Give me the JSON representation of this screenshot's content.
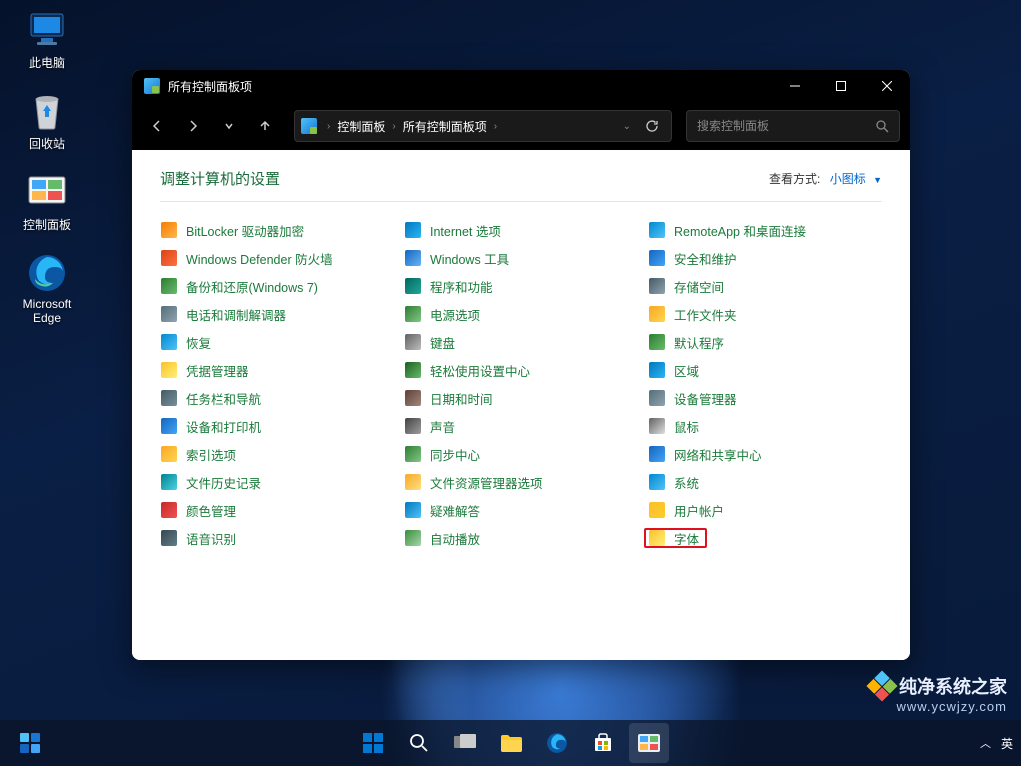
{
  "desktop": {
    "icons": [
      {
        "name": "this-pc",
        "label": "此电脑"
      },
      {
        "name": "recycle-bin",
        "label": "回收站"
      },
      {
        "name": "control-panel",
        "label": "控制面板"
      },
      {
        "name": "edge",
        "label": "Microsoft Edge"
      }
    ]
  },
  "window": {
    "title": "所有控制面板项",
    "breadcrumb": [
      "控制面板",
      "所有控制面板项"
    ],
    "search_placeholder": "搜索控制面板",
    "heading": "调整计算机的设置",
    "viewby_label": "查看方式:",
    "viewby_value": "小图标"
  },
  "items": {
    "col1": [
      {
        "name": "bitlocker",
        "label": "BitLocker 驱动器加密",
        "bg": "linear-gradient(135deg,#f57c00,#ffb74d)"
      },
      {
        "name": "defender",
        "label": "Windows Defender 防火墙",
        "bg": "linear-gradient(135deg,#d84315,#ff7043)"
      },
      {
        "name": "backup",
        "label": "备份和还原(Windows 7)",
        "bg": "linear-gradient(135deg,#2e7d32,#66bb6a)"
      },
      {
        "name": "phone-modem",
        "label": "电话和调制解调器",
        "bg": "linear-gradient(135deg,#546e7a,#90a4ae)"
      },
      {
        "name": "recovery",
        "label": "恢复",
        "bg": "linear-gradient(135deg,#0288d1,#4fc3f7)"
      },
      {
        "name": "credential",
        "label": "凭据管理器",
        "bg": "linear-gradient(135deg,#fbc02d,#fff176)"
      },
      {
        "name": "taskbar-nav",
        "label": "任务栏和导航",
        "bg": "linear-gradient(135deg,#455a64,#78909c)"
      },
      {
        "name": "devices-printers",
        "label": "设备和打印机",
        "bg": "linear-gradient(135deg,#1565c0,#42a5f5)"
      },
      {
        "name": "index-options",
        "label": "索引选项",
        "bg": "linear-gradient(135deg,#f9a825,#ffd54f)"
      },
      {
        "name": "file-history",
        "label": "文件历史记录",
        "bg": "linear-gradient(135deg,#00838f,#4dd0e1)"
      },
      {
        "name": "color-mgmt",
        "label": "颜色管理",
        "bg": "linear-gradient(135deg,#c62828,#ef5350)"
      },
      {
        "name": "speech",
        "label": "语音识别",
        "bg": "linear-gradient(135deg,#37474f,#607d8b)"
      }
    ],
    "col2": [
      {
        "name": "internet-options",
        "label": "Internet 选项",
        "bg": "linear-gradient(135deg,#0277bd,#29b6f6)"
      },
      {
        "name": "windows-tools",
        "label": "Windows 工具",
        "bg": "linear-gradient(135deg,#1565c0,#64b5f6)"
      },
      {
        "name": "programs",
        "label": "程序和功能",
        "bg": "linear-gradient(135deg,#00695c,#26a69a)"
      },
      {
        "name": "power",
        "label": "电源选项",
        "bg": "linear-gradient(135deg,#2e7d32,#81c784)"
      },
      {
        "name": "keyboard",
        "label": "键盘",
        "bg": "linear-gradient(135deg,#616161,#bdbdbd)"
      },
      {
        "name": "ease-access",
        "label": "轻松使用设置中心",
        "bg": "linear-gradient(135deg,#1b5e20,#66bb6a)"
      },
      {
        "name": "date-time",
        "label": "日期和时间",
        "bg": "linear-gradient(135deg,#5d4037,#a1887f)"
      },
      {
        "name": "sound",
        "label": "声音",
        "bg": "linear-gradient(135deg,#424242,#9e9e9e)"
      },
      {
        "name": "sync-center",
        "label": "同步中心",
        "bg": "linear-gradient(135deg,#2e7d32,#81c784)"
      },
      {
        "name": "explorer-options",
        "label": "文件资源管理器选项",
        "bg": "linear-gradient(135deg,#f9a825,#ffe082)"
      },
      {
        "name": "troubleshoot",
        "label": "疑难解答",
        "bg": "linear-gradient(135deg,#0277bd,#4fc3f7)"
      },
      {
        "name": "autoplay",
        "label": "自动播放",
        "bg": "linear-gradient(135deg,#388e3c,#a5d6a7)"
      }
    ],
    "col3": [
      {
        "name": "remoteapp",
        "label": "RemoteApp 和桌面连接",
        "bg": "linear-gradient(135deg,#0288d1,#4fc3f7)"
      },
      {
        "name": "security-maint",
        "label": "安全和维护",
        "bg": "linear-gradient(135deg,#1565c0,#42a5f5)"
      },
      {
        "name": "storage",
        "label": "存储空间",
        "bg": "linear-gradient(135deg,#455a64,#90a4ae)"
      },
      {
        "name": "work-folders",
        "label": "工作文件夹",
        "bg": "linear-gradient(135deg,#f9a825,#ffd54f)"
      },
      {
        "name": "default-programs",
        "label": "默认程序",
        "bg": "linear-gradient(135deg,#2e7d32,#66bb6a)"
      },
      {
        "name": "region",
        "label": "区域",
        "bg": "linear-gradient(135deg,#0277bd,#29b6f6)"
      },
      {
        "name": "device-manager",
        "label": "设备管理器",
        "bg": "linear-gradient(135deg,#546e7a,#90a4ae)"
      },
      {
        "name": "mouse",
        "label": "鼠标",
        "bg": "linear-gradient(135deg,#616161,#e0e0e0)"
      },
      {
        "name": "network-sharing",
        "label": "网络和共享中心",
        "bg": "linear-gradient(135deg,#1565c0,#42a5f5)"
      },
      {
        "name": "system",
        "label": "系统",
        "bg": "linear-gradient(135deg,#0288d1,#4fc3f7)"
      },
      {
        "name": "user-accounts",
        "label": "用户帐户",
        "bg": "linear-gradient(135deg,#fbc02d,#ffca28)"
      },
      {
        "name": "fonts",
        "label": "字体",
        "bg": "linear-gradient(135deg,#fbc02d,#fff176)",
        "highlight": true
      }
    ]
  },
  "tray": {
    "lang": "英"
  },
  "watermark": {
    "main": "纯净系统之家",
    "sub": "www.ycwjzy.com"
  }
}
